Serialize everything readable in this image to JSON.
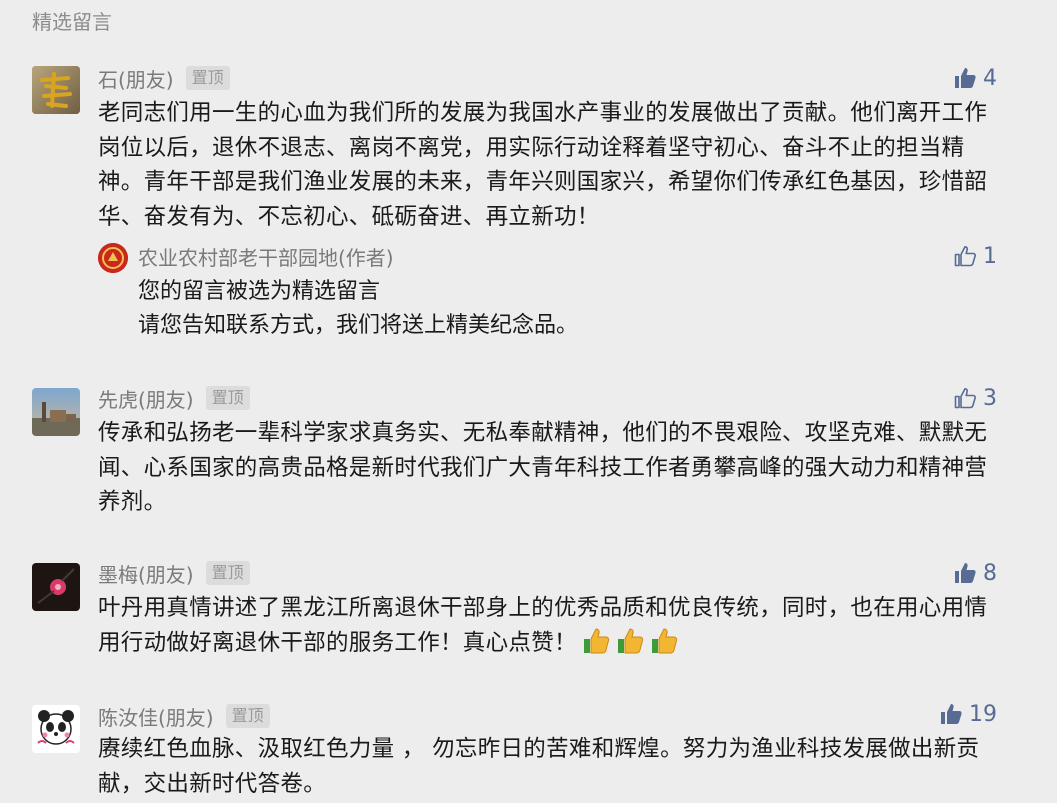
{
  "section_title": "精选留言",
  "comments": [
    {
      "name": "石(朋友)",
      "pin": "置顶",
      "likes": "4",
      "liked": true,
      "text": "老同志们用一生的心血为我们所的发展为我国水产事业的发展做出了贡献。他们离开工作岗位以后，退休不退志、离岗不离党，用实际行动诠释着坚守初心、奋斗不止的担当精神。青年干部是我们渔业发展的未来，青年兴则国家兴，希望你们传承红色基因，珍惜韶华、奋发有为、不忘初心、砥砺奋进、再立新功！",
      "reply": {
        "name": "农业农村部老干部园地(作者)",
        "likes": "1",
        "liked": false,
        "lines": [
          "您的留言被选为精选留言",
          "请您告知联系方式，我们将送上精美纪念品。"
        ]
      }
    },
    {
      "name": "先虎(朋友)",
      "pin": "置顶",
      "likes": "3",
      "liked": false,
      "text": "传承和弘扬老一辈科学家求真务实、无私奉献精神，他们的不畏艰险、攻坚克难、默默无闻、心系国家的高贵品格是新时代我们广大青年科技工作者勇攀高峰的强大动力和精神营养剂。"
    },
    {
      "name": "墨梅(朋友)",
      "pin": "置顶",
      "likes": "8",
      "liked": true,
      "text": "叶丹用真情讲述了黑龙江所离退休干部身上的优秀品质和优良传统，同时，也在用心用情用行动做好离退休干部的服务工作！真心点赞！"
    },
    {
      "name": "陈汝佳(朋友)",
      "pin": "置顶",
      "likes": "19",
      "liked": true,
      "text": "赓续红色血脉、汲取红色力量 ， 勿忘昨日的苦难和辉煌。努力为渔业科技发展做出新贡献，交出新时代答卷。"
    }
  ],
  "colors": {
    "background": "#ededed",
    "like_blue": "#586b94",
    "author_red": "#c8281e"
  }
}
